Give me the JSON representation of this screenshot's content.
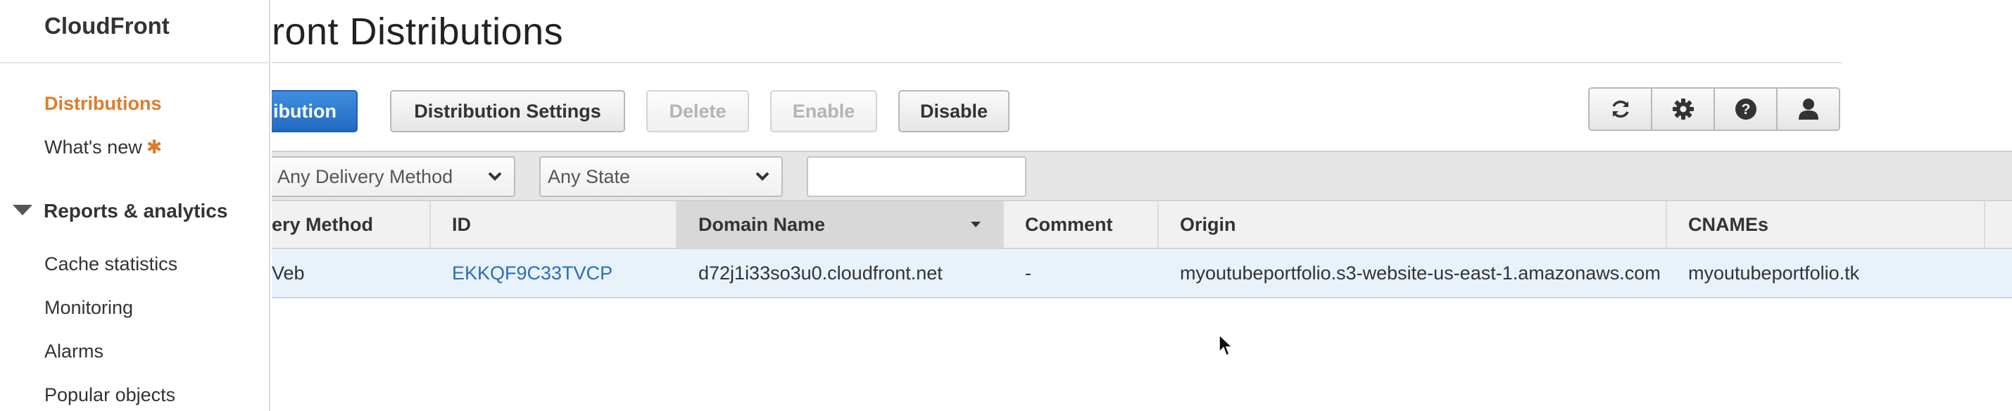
{
  "sidebar": {
    "title": "CloudFront",
    "items": [
      {
        "label": "Distributions",
        "active": true
      },
      {
        "label": "What's new",
        "badge": "✱"
      }
    ],
    "section": {
      "label": "Reports & analytics",
      "items": [
        "Cache statistics",
        "Monitoring",
        "Alarms",
        "Popular objects"
      ]
    }
  },
  "page": {
    "title": "ront Distributions"
  },
  "toolbar": {
    "create_label": "ibution",
    "settings_label": "Distribution Settings",
    "delete_label": "Delete",
    "enable_label": "Enable",
    "disable_label": "Disable",
    "icons": [
      "refresh-icon",
      "gear-icon",
      "help-icon",
      "user-icon"
    ]
  },
  "filters": {
    "delivery_method": "Any Delivery Method",
    "state": "Any State",
    "search_value": ""
  },
  "table": {
    "columns": [
      "ery Method",
      "ID",
      "Domain Name",
      "Comment",
      "Origin",
      "CNAMEs"
    ],
    "sorted_column": "Domain Name",
    "rows": [
      {
        "delivery_method": "Veb",
        "id": "EKKQF9C33TVCP",
        "domain_name": "d72j1i33so3u0.cloudfront.net",
        "comment": "-",
        "origin": "myoutubeportfolio.s3-website-us-east-1.amazonaws.com",
        "cnames": "myoutubeportfolio.tk"
      }
    ]
  },
  "colors": {
    "accent": "#e07b2a",
    "primary_button": "#2a6fc9",
    "link": "#2a6dba",
    "selected_row": "#e8f2fb"
  }
}
